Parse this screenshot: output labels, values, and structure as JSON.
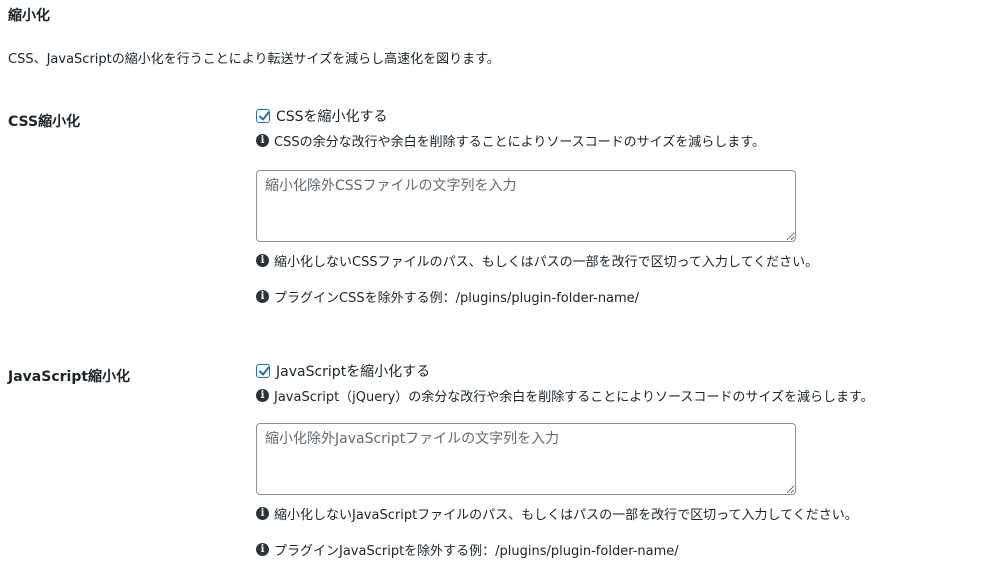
{
  "section": {
    "title": "縮小化",
    "description": "CSS、JavaScriptの縮小化を行うことにより転送サイズを減らし高速化を図ります。"
  },
  "css": {
    "label": "CSS縮小化",
    "checkbox_label": "CSSを縮小化する",
    "checked": true,
    "help": "CSSの余分な改行や余白を削除することによりソースコードのサイズを減らします。",
    "textarea_placeholder": "縮小化除外CSSファイルの文字列を入力",
    "textarea_value": "",
    "exclude_help": "縮小化しないCSSファイルのパス、もしくはパスの一部を改行で区切って入力してください。",
    "example": "プラグインCSSを除外する例：/plugins/plugin-folder-name/"
  },
  "js": {
    "label": "JavaScript縮小化",
    "checkbox_label": "JavaScriptを縮小化する",
    "checked": true,
    "help": "JavaScript（jQuery）の余分な改行や余白を削除することによりソースコードのサイズを減らします。",
    "textarea_placeholder": "縮小化除外JavaScriptファイルの文字列を入力",
    "textarea_value": "",
    "exclude_help": "縮小化しないJavaScriptファイルのパス、もしくはパスの一部を改行で区切って入力してください。",
    "example": "プラグインJavaScriptを除外する例：/plugins/plugin-folder-name/"
  },
  "icons": {
    "info": "info-icon",
    "checkmark": "checkmark-icon",
    "resize": "resize-handle-icon"
  },
  "colors": {
    "checkbox_border": "#2271b1",
    "text": "#1d2327",
    "placeholder": "#646970"
  }
}
